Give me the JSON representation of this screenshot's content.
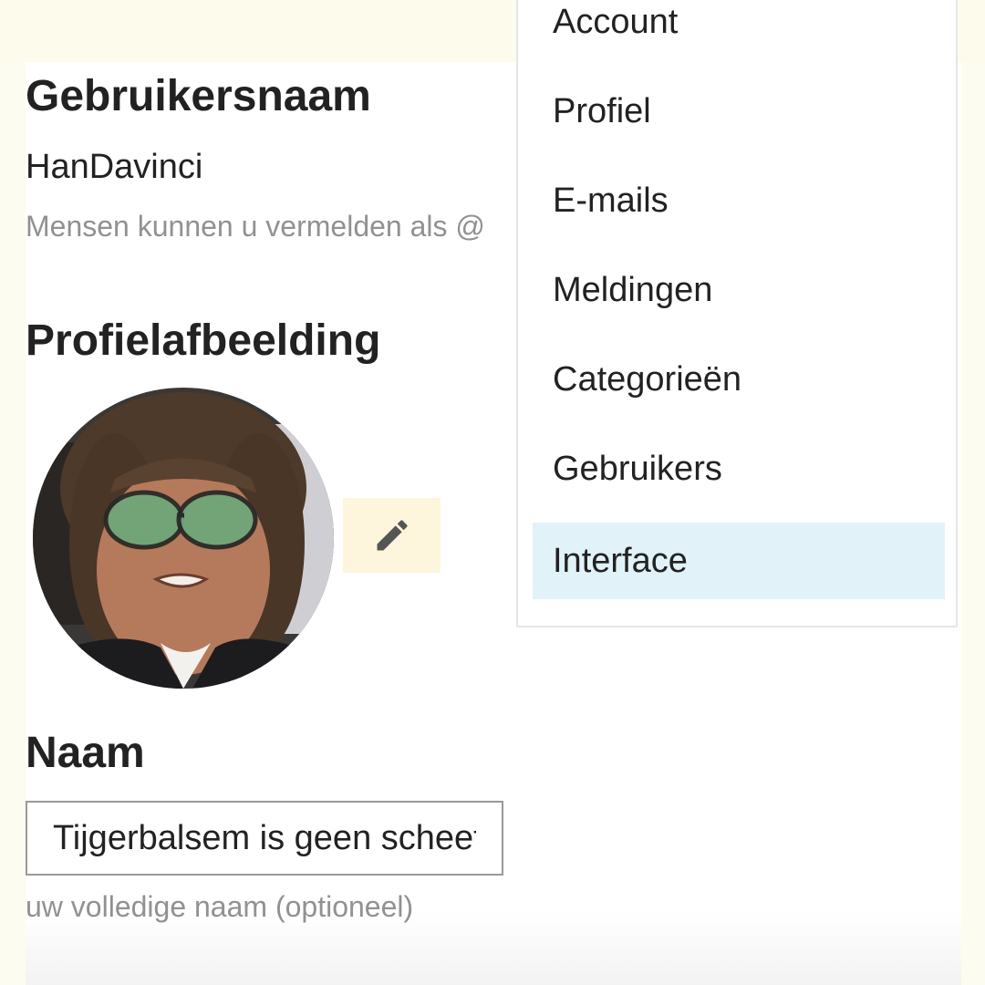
{
  "username": {
    "heading": "Gebruikersnaam",
    "value": "HanDavinci",
    "hint": "Mensen kunnen u vermelden als @"
  },
  "profile_picture": {
    "heading": "Profielafbeelding",
    "edit_icon": "pencil-icon"
  },
  "name": {
    "heading": "Naam",
    "value": "Tijgerbalsem is geen scheet",
    "hint": "uw volledige naam (optioneel)"
  },
  "menu": {
    "items": [
      {
        "label": "Account"
      },
      {
        "label": "Profiel"
      },
      {
        "label": "E-mails"
      },
      {
        "label": "Meldingen"
      },
      {
        "label": "Categorieën"
      },
      {
        "label": "Gebruikers"
      },
      {
        "label": "Interface",
        "active": true
      }
    ]
  },
  "colors": {
    "active_item_bg": "#e2f2f9",
    "edit_button_bg": "#fdf6dc",
    "hint_text": "#919191"
  }
}
